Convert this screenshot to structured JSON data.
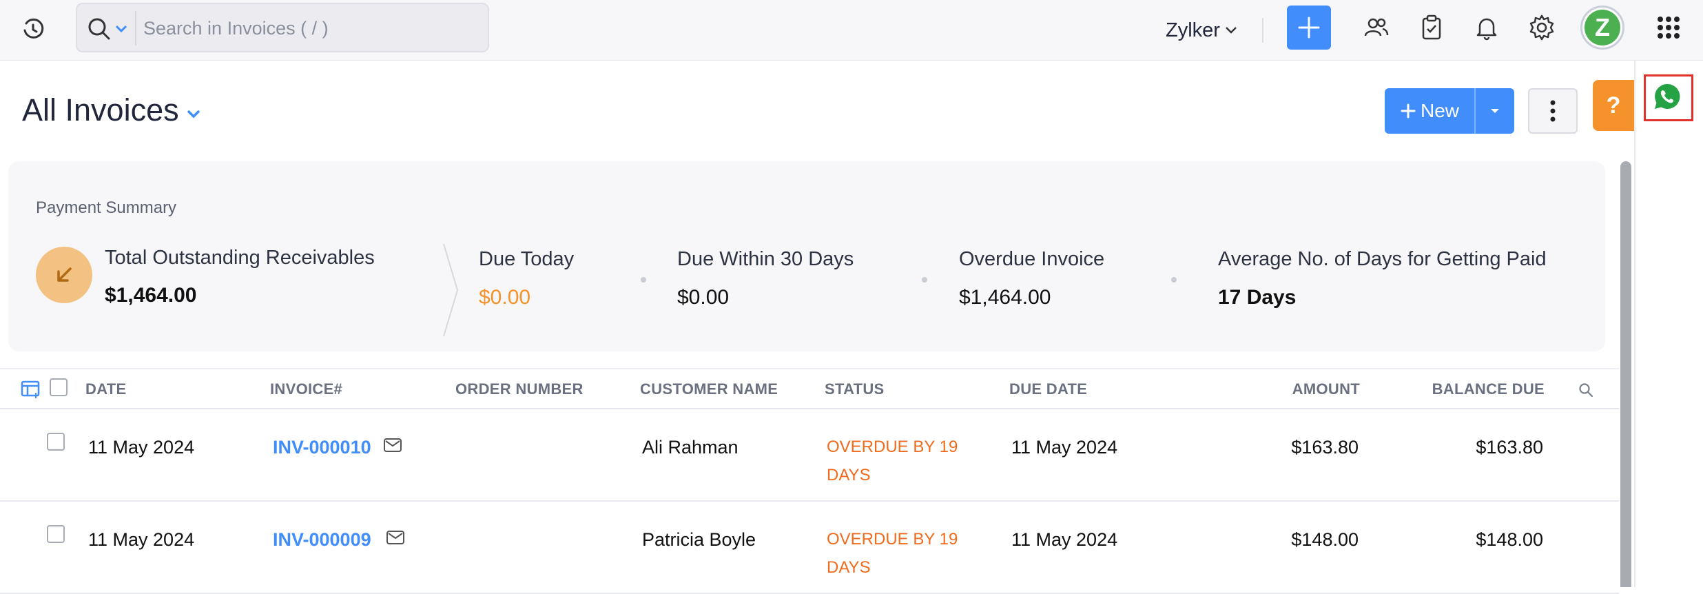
{
  "topbar": {
    "search_placeholder": "Search in Invoices ( / )",
    "org_name": "Zylker",
    "avatar_initial": "Z"
  },
  "header": {
    "title": "All Invoices",
    "new_label": "New",
    "help_label": "?"
  },
  "summary": {
    "heading": "Payment Summary",
    "receivables_label": "Total Outstanding Receivables",
    "receivables_value": "$1,464.00",
    "metrics": [
      {
        "label": "Due Today",
        "value": "$0.00",
        "color": "#f6922b"
      },
      {
        "label": "Due Within 30 Days",
        "value": "$0.00"
      },
      {
        "label": "Overdue Invoice",
        "value": "$1,464.00"
      },
      {
        "label": "Average No. of Days for Getting Paid",
        "value": "17 Days"
      }
    ]
  },
  "table": {
    "columns": {
      "date": "DATE",
      "invoice": "INVOICE#",
      "order": "ORDER NUMBER",
      "customer": "CUSTOMER NAME",
      "status": "STATUS",
      "due_date": "DUE DATE",
      "amount": "AMOUNT",
      "balance": "BALANCE DUE"
    },
    "rows": [
      {
        "date": "11 May 2024",
        "invoice": "INV-000010",
        "order": "",
        "customer": "Ali Rahman",
        "status": "OVERDUE BY 19 DAYS",
        "due_date": "11 May 2024",
        "amount": "$163.80",
        "balance": "$163.80"
      },
      {
        "date": "11 May 2024",
        "invoice": "INV-000009",
        "order": "",
        "customer": "Patricia Boyle",
        "status": "OVERDUE BY 19 DAYS",
        "due_date": "11 May 2024",
        "amount": "$148.00",
        "balance": "$148.00"
      }
    ]
  },
  "colors": {
    "accent": "#408dfb",
    "overdue": "#f06b1e",
    "due_today": "#f6922b",
    "whatsapp": "#25a244",
    "highlight_box": "#e0322b"
  }
}
